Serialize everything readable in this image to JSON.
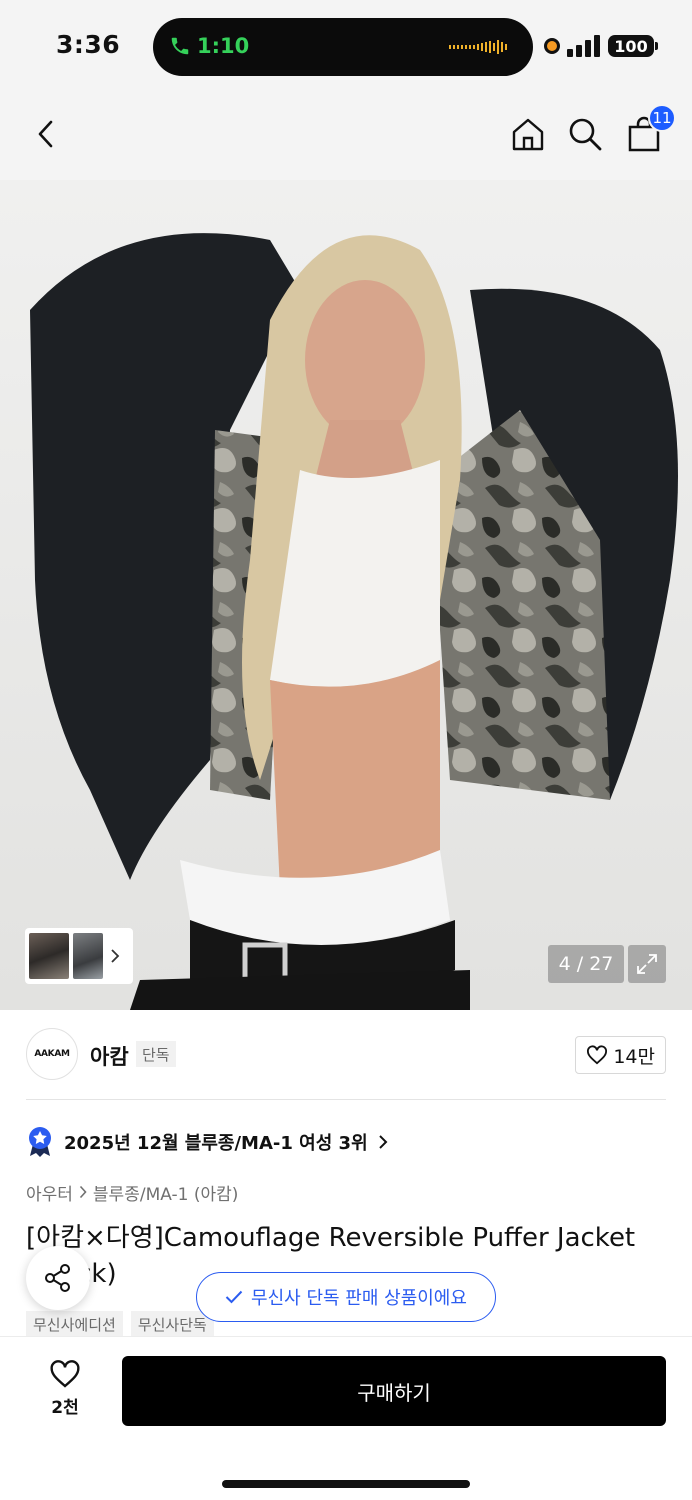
{
  "status_bar": {
    "time": "3:36",
    "call_timer": "1:10",
    "battery": "100"
  },
  "nav": {
    "cart_count": "11"
  },
  "hero": {
    "image_counter": "4 / 27"
  },
  "brand": {
    "logo_text": "AAKAM",
    "name": "아캄",
    "tag": "단독",
    "likes": "14만"
  },
  "ranking": {
    "text": "2025년 12월 블루종/MA-1 여성 3위"
  },
  "breadcrumb": {
    "items": [
      "아우터",
      "블루종/MA-1 (아캄)"
    ]
  },
  "product": {
    "title": "[아캄×다영]Camouflage Reversible Puffer Jacket (Black)",
    "tags": [
      "무신사에디션",
      "무신사단독"
    ]
  },
  "toast": {
    "text": "무신사 단독 판매 상품이에요"
  },
  "bottom_bar": {
    "wish_count": "2천",
    "buy_label": "구매하기"
  },
  "colors": {
    "accent_blue": "#1d5cff",
    "call_green": "#35d15a",
    "buy_button": "#000000"
  }
}
